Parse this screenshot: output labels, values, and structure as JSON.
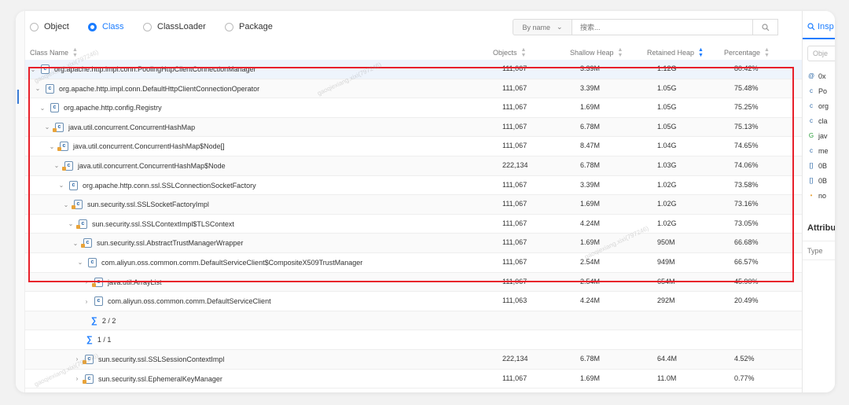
{
  "toolbar": {
    "radios": [
      {
        "label": "Object",
        "selected": false
      },
      {
        "label": "Class",
        "selected": true
      },
      {
        "label": "ClassLoader",
        "selected": false
      },
      {
        "label": "Package",
        "selected": false
      }
    ],
    "sort_by": "By name",
    "search_placeholder": "搜索..."
  },
  "columns": {
    "class_name": "Class Name",
    "objects": "Objects",
    "shallow_heap": "Shallow Heap",
    "retained_heap": "Retained Heap",
    "percentage": "Percentage"
  },
  "rows": [
    {
      "name": "org.apache.http.impl.conn.PoolingHttpClientConnectionManager",
      "objects": "111,067",
      "shallow": "3.39M",
      "retained": "1.12G",
      "percentage": "80.42%",
      "expand": "open",
      "lock": false
    },
    {
      "name": "org.apache.http.impl.conn.DefaultHttpClientConnectionOperator",
      "objects": "111,067",
      "shallow": "3.39M",
      "retained": "1.05G",
      "percentage": "75.48%",
      "expand": "open",
      "lock": false
    },
    {
      "name": "org.apache.http.config.Registry",
      "objects": "111,067",
      "shallow": "1.69M",
      "retained": "1.05G",
      "percentage": "75.25%",
      "expand": "open",
      "lock": false
    },
    {
      "name": "java.util.concurrent.ConcurrentHashMap",
      "objects": "111,067",
      "shallow": "6.78M",
      "retained": "1.05G",
      "percentage": "75.13%",
      "expand": "open",
      "lock": true
    },
    {
      "name": "java.util.concurrent.ConcurrentHashMap$Node[]",
      "objects": "111,067",
      "shallow": "8.47M",
      "retained": "1.04G",
      "percentage": "74.65%",
      "expand": "open",
      "lock": true
    },
    {
      "name": "java.util.concurrent.ConcurrentHashMap$Node",
      "objects": "222,134",
      "shallow": "6.78M",
      "retained": "1.03G",
      "percentage": "74.06%",
      "expand": "open",
      "lock": true
    },
    {
      "name": "org.apache.http.conn.ssl.SSLConnectionSocketFactory",
      "objects": "111,067",
      "shallow": "3.39M",
      "retained": "1.02G",
      "percentage": "73.58%",
      "expand": "open",
      "lock": false
    },
    {
      "name": "sun.security.ssl.SSLSocketFactoryImpl",
      "objects": "111,067",
      "shallow": "1.69M",
      "retained": "1.02G",
      "percentage": "73.16%",
      "expand": "open",
      "lock": true
    },
    {
      "name": "sun.security.ssl.SSLContextImpl$TLSContext",
      "objects": "111,067",
      "shallow": "4.24M",
      "retained": "1.02G",
      "percentage": "73.05%",
      "expand": "open",
      "lock": true
    },
    {
      "name": "sun.security.ssl.AbstractTrustManagerWrapper",
      "objects": "111,067",
      "shallow": "1.69M",
      "retained": "950M",
      "percentage": "66.68%",
      "expand": "open",
      "lock": true
    },
    {
      "name": "com.aliyun.oss.common.comm.DefaultServiceClient$CompositeX509TrustManager",
      "objects": "111,067",
      "shallow": "2.54M",
      "retained": "949M",
      "percentage": "66.57%",
      "expand": "open",
      "lock": false
    },
    {
      "name": "java.util.ArrayList",
      "objects": "111,067",
      "shallow": "2.54M",
      "retained": "654M",
      "percentage": "45.90%",
      "expand": "closed",
      "lock": true
    },
    {
      "name": "com.aliyun.oss.common.comm.DefaultServiceClient",
      "objects": "111,063",
      "shallow": "4.24M",
      "retained": "292M",
      "percentage": "20.49%",
      "expand": "closed",
      "lock": false
    },
    {
      "name": "2 / 2",
      "objects": "",
      "shallow": "",
      "retained": "",
      "percentage": "",
      "expand": "sigma",
      "lock": false
    },
    {
      "name": "1 / 1",
      "objects": "",
      "shallow": "",
      "retained": "",
      "percentage": "",
      "expand": "sigma",
      "lock": false
    },
    {
      "name": "sun.security.ssl.SSLSessionContextImpl",
      "objects": "222,134",
      "shallow": "6.78M",
      "retained": "64.4M",
      "percentage": "4.52%",
      "expand": "closed",
      "lock": true
    },
    {
      "name": "sun.security.ssl.EphemeralKeyManager",
      "objects": "111,067",
      "shallow": "1.69M",
      "retained": "11.0M",
      "percentage": "0.77%",
      "expand": "closed",
      "lock": true
    }
  ],
  "right_panel": {
    "tab": "Insp",
    "filter_placeholder": "Obje",
    "items": [
      {
        "icon": "@",
        "text": "0x"
      },
      {
        "icon": "c",
        "text": "Po"
      },
      {
        "icon": "c",
        "text": "org"
      },
      {
        "icon": "c",
        "text": "cla"
      },
      {
        "icon": "G",
        "text": "jav"
      },
      {
        "icon": "c",
        "text": "me"
      },
      {
        "icon": "[]",
        "text": "0B"
      },
      {
        "icon": "[]",
        "text": "0B"
      },
      {
        "icon": "•",
        "text": "no"
      }
    ],
    "attributes_title": "Attribu",
    "type_label": "Type"
  },
  "watermarks": [
    "gaoqiexiang.xixi(797246)",
    "gaoqiexiang.xixi(797246)",
    "gaoqiexiang.xixi(797246)",
    "gaoqiexiang.xixi(797246)"
  ],
  "colors": {
    "accent": "#1a7cff",
    "highlight_box": "#e8202a"
  }
}
